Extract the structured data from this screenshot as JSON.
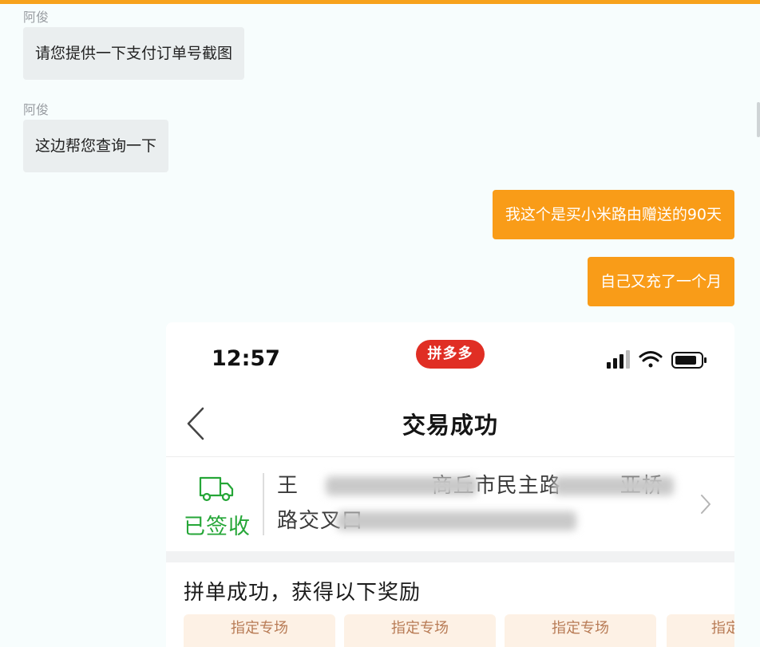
{
  "chat": {
    "messages": [
      {
        "sender": "阿俊",
        "text": "请您提供一下支付订单号截图",
        "direction": "in"
      },
      {
        "sender": "阿俊",
        "text": "这边帮您查询一下",
        "direction": "in"
      },
      {
        "text": "我这个是买小米路由赠送的90天",
        "direction": "out"
      },
      {
        "text": "自己又充了一个月",
        "direction": "out"
      }
    ]
  },
  "screenshot": {
    "status_bar": {
      "time": "12:57",
      "app_logo_text": "拼多多",
      "icons": [
        "cellular-signal-icon",
        "wifi-icon",
        "battery-icon"
      ]
    },
    "nav": {
      "title": "交易成功",
      "back_icon": "chevron-left-icon"
    },
    "delivery": {
      "status": "已签收",
      "icon": "truck-icon",
      "address_line1": "王                  商丘市民主路        亚桥",
      "address_line2": "路交叉口",
      "arrow_icon": "chevron-right-icon"
    },
    "rewards": {
      "title": "拼单成功，获得以下奖励",
      "coupons": [
        "指定专场",
        "指定专场",
        "指定专场",
        "指定"
      ]
    }
  },
  "colors": {
    "accent": "#f7a21c",
    "outgoing_bubble": "#f99c18",
    "incoming_bubble": "#eaeeef",
    "pdd_red": "#e02e24",
    "signed_green": "#25a637"
  }
}
